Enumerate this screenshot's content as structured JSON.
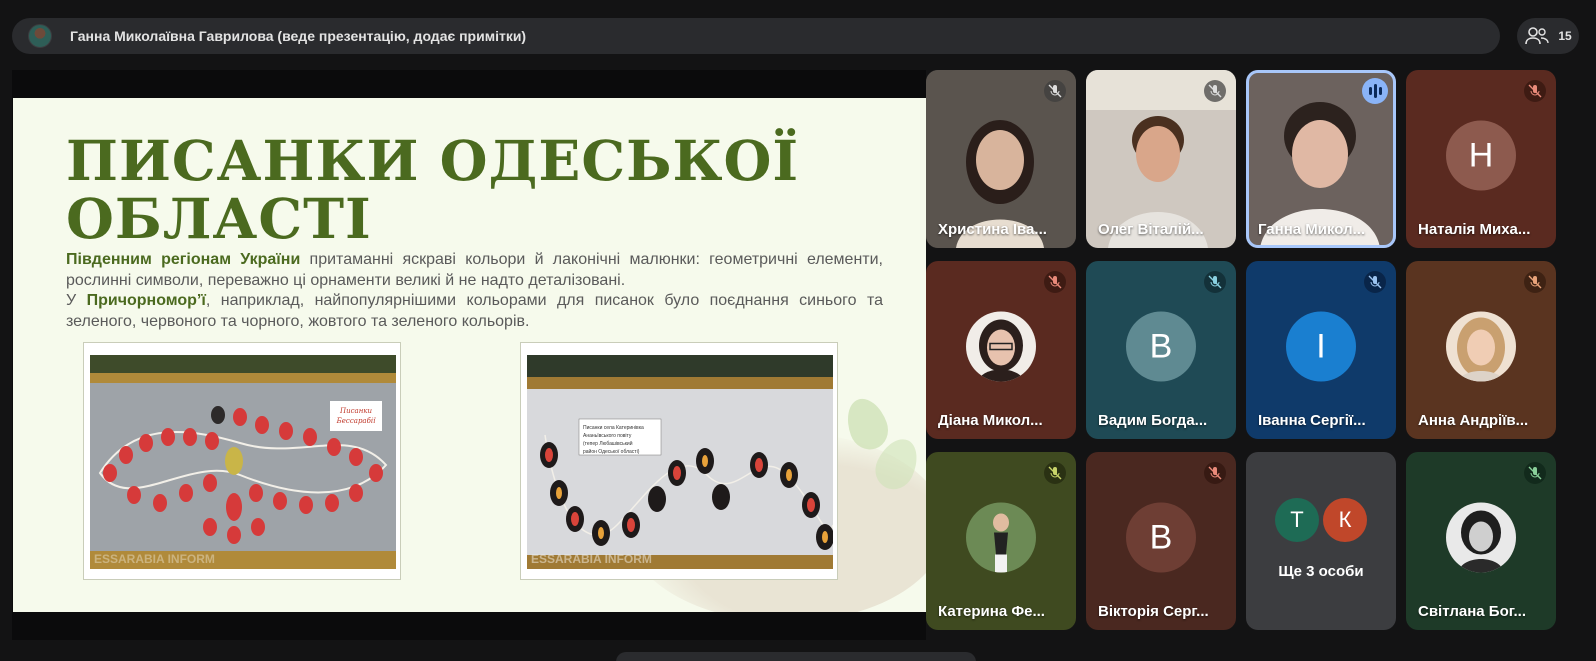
{
  "presenter_bar": {
    "title": "Ганна Миколаївна Гаврилова (веде презентацію, додає примітки)"
  },
  "people_count": "15",
  "slide": {
    "title_line1": "ПИСАНКИ ОДЕСЬКОЇ",
    "title_line2": "ОБЛАСТІ",
    "p1_bold": "Південним регіонам України",
    "p1_rest": " притаманні яскраві кольори й лаконічні малюнки: геометричні елементи, рослинні символи, переважно ці орнаменти великі й не надто деталізовані.",
    "p2_start": "У ",
    "p2_bold": "Причорномор’ї",
    "p2_rest": ", наприклад, найпопулярнішими кольорами для писанок було поєднання синього та зеленого, червоного та чорного, жовтого та зеленого кольорів.",
    "photo1_sign": "Писанки Бессарабії",
    "photo1_watermark": "ESSARABIA INFORM",
    "photo2_sign": "Писанки села Катеринівка Ананьївського повіту (тепер Любашівський район Одеської області)",
    "photo2_watermark": "ESSARABIA INFORM"
  },
  "participants": [
    {
      "name": "Христина Іва...",
      "mic": "muted",
      "kind": "video"
    },
    {
      "name": "Олег Віталій...",
      "mic": "muted",
      "kind": "video"
    },
    {
      "name": "Ганна Микол...",
      "mic": "speaking",
      "kind": "video"
    },
    {
      "name": "Наталія Миха...",
      "mic": "muted",
      "kind": "letter",
      "letter": "Н",
      "bg": "#5a2a20",
      "avatar": "#8d5a4e"
    },
    {
      "name": "Діана Микол...",
      "mic": "muted",
      "kind": "photo",
      "bg": "#5a2a20"
    },
    {
      "name": "Вадим Богда...",
      "mic": "muted",
      "kind": "letter",
      "letter": "В",
      "bg": "#1f4a55",
      "avatar": "#5f8a92"
    },
    {
      "name": "Іванна Сергії...",
      "mic": "muted",
      "kind": "letter",
      "letter": "І",
      "bg": "#0f3a6a",
      "avatar": "#1a7fd0"
    },
    {
      "name": "Анна Андріїв...",
      "mic": "muted",
      "kind": "photo",
      "bg": "#5a3420"
    },
    {
      "name": "Катерина Фе...",
      "mic": "muted",
      "kind": "photo",
      "bg": "#3f4a20"
    },
    {
      "name": "Вікторія Серг...",
      "mic": "muted",
      "kind": "letter",
      "letter": "В",
      "bg": "#4a2820",
      "avatar": "#6e3e34"
    },
    {
      "name": "Світлана Бог...",
      "mic": "muted",
      "kind": "photo",
      "bg": "#1e3a28"
    }
  ],
  "more": {
    "label": "Ще 3 особи",
    "a1": "Т",
    "a2": "К",
    "a1_color": "#1e6b55",
    "a2_color": "#c0472a"
  }
}
